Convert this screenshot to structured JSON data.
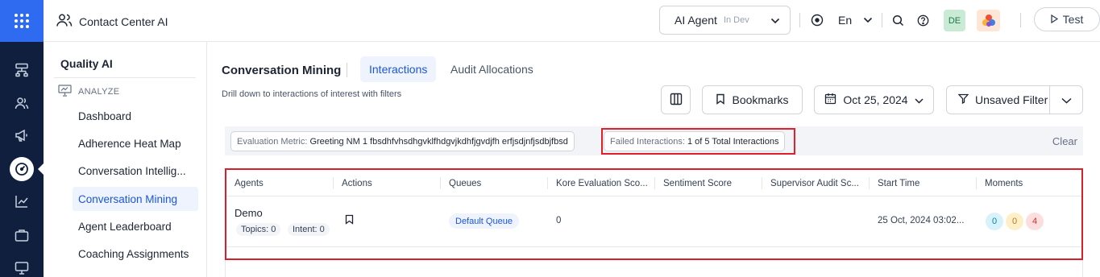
{
  "header": {
    "app_title": "Contact Center AI",
    "agent_name": "AI Agent",
    "agent_status": "In Dev",
    "language": "En",
    "user_initials": "DE",
    "test_label": "Test"
  },
  "sidebar": {
    "title": "Quality AI",
    "section": "ANALYZE",
    "items": [
      {
        "label": "Dashboard"
      },
      {
        "label": "Adherence Heat Map"
      },
      {
        "label": "Conversation Intellig..."
      },
      {
        "label": "Conversation Mining",
        "active": true
      },
      {
        "label": "Agent Leaderboard"
      },
      {
        "label": "Coaching Assignments"
      }
    ]
  },
  "main": {
    "title": "Conversation Mining",
    "tabs": [
      {
        "label": "Interactions",
        "active": true
      },
      {
        "label": "Audit Allocations"
      }
    ],
    "subtitle": "Drill down to interactions of interest with filters",
    "toolbar": {
      "bookmarks_label": "Bookmarks",
      "date_label": "Oct 25, 2024",
      "filter_label": "Unsaved Filter"
    },
    "filters": [
      {
        "key": "Evaluation Metric:",
        "value": "Greeting NM 1 fbsdhfvhsdhgvklfhdgvjkdhfjgvdjfh erfjsdjnfjsdbjfbsd"
      },
      {
        "key": "Failed Interactions:",
        "value": "1 of 5 Total Interactions"
      }
    ],
    "clear_label": "Clear",
    "table": {
      "columns": [
        "Agents",
        "Actions",
        "Queues",
        "Kore Evaluation Sco...",
        "Sentiment Score",
        "Supervisor Audit Sc...",
        "Start Time",
        "Moments"
      ],
      "rows": [
        {
          "agent": "Demo",
          "topics": "Topics: 0",
          "intent": "Intent: 0",
          "queue": "Default Queue",
          "kore_score": "0",
          "sentiment": "",
          "supervisor_audit": "",
          "start_time": "25 Oct, 2024 03:02...",
          "moments": [
            "0",
            "0",
            "4"
          ]
        }
      ]
    }
  },
  "colors": {
    "rail_bg": "#0f1f3d",
    "accent": "#2f6bf0",
    "highlight_border": "#e0202c",
    "moment_colors": [
      "#d7f2fb",
      "#fdf0c8",
      "#fddede"
    ]
  }
}
